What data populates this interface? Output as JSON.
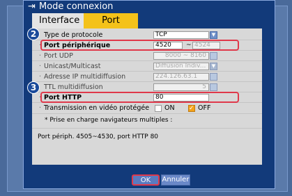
{
  "window": {
    "title": "Mode connexion"
  },
  "tabs": [
    {
      "label": "Interface"
    },
    {
      "label": "Port"
    }
  ],
  "badges": {
    "b2": "2",
    "b3": "3"
  },
  "rows": {
    "protocol": {
      "label": "Type de protocole",
      "value": "TCP"
    },
    "device_port": {
      "label": "Port périphérique",
      "value": "4520",
      "sep": "~",
      "value2": "4524"
    },
    "udp_port": {
      "label": "Port UDP",
      "value": "8000 ~ 8160"
    },
    "unicast": {
      "label": "Unicast/Multicast",
      "value": "Diffusion Indiv..."
    },
    "multicast_ip": {
      "label": "Adresse IP multidiffusion",
      "value": "224.126.63.1"
    },
    "ttl": {
      "label": "TTL multidiffusion",
      "value": "5"
    },
    "http_port": {
      "label": "Port HTTP",
      "value": "80"
    },
    "protected": {
      "label": "Transmission en vidéo protégée",
      "on_label": "ON",
      "off_label": "OFF"
    }
  },
  "notes": {
    "line1": "* Prise en charge navigateurs multiples :",
    "line2": "Port périph. 4505~4530, port HTTP 80"
  },
  "buttons": {
    "ok": "OK",
    "cancel": "Annuler"
  },
  "colors": {
    "accent": "#f4c21a",
    "highlight": "#e0384a",
    "window_bg": "#123a7a"
  }
}
